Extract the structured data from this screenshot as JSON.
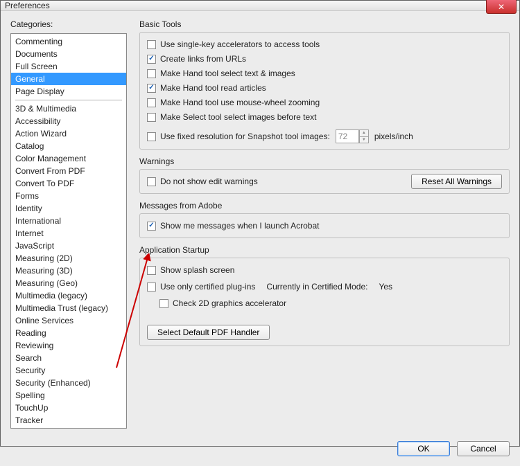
{
  "window": {
    "title": "Preferences"
  },
  "categories_label": "Categories:",
  "categories_top": [
    "Commenting",
    "Documents",
    "Full Screen",
    "General",
    "Page Display"
  ],
  "categories_selected": "General",
  "categories_rest": [
    "3D & Multimedia",
    "Accessibility",
    "Action Wizard",
    "Catalog",
    "Color Management",
    "Convert From PDF",
    "Convert To PDF",
    "Forms",
    "Identity",
    "International",
    "Internet",
    "JavaScript",
    "Measuring (2D)",
    "Measuring (3D)",
    "Measuring (Geo)",
    "Multimedia (legacy)",
    "Multimedia Trust (legacy)",
    "Online Services",
    "Reading",
    "Reviewing",
    "Search",
    "Security",
    "Security (Enhanced)",
    "Spelling",
    "TouchUp",
    "Tracker"
  ],
  "groups": {
    "basic": {
      "title": "Basic Tools",
      "opts": {
        "single_key": "Use single-key accelerators to access tools",
        "create_links": "Create links from URLs",
        "hand_text_images": "Make Hand tool select text & images",
        "hand_articles": "Make Hand tool read articles",
        "hand_wheel": "Make Hand tool use mouse-wheel zooming",
        "select_images": "Make Select tool select images before text",
        "snapshot": "Use fixed resolution for Snapshot tool images:",
        "snapshot_value": "72",
        "snapshot_unit": "pixels/inch"
      }
    },
    "warnings": {
      "title": "Warnings",
      "opt": "Do not show edit warnings",
      "reset": "Reset All Warnings"
    },
    "messages": {
      "title": "Messages from Adobe",
      "opt": "Show me messages when I launch Acrobat"
    },
    "startup": {
      "title": "Application Startup",
      "splash": "Show splash screen",
      "certified": "Use only certified plug-ins",
      "certified_status_label": "Currently in Certified Mode:",
      "certified_status_value": "Yes",
      "gfx": "Check 2D graphics accelerator",
      "handler": "Select Default PDF Handler"
    }
  },
  "footer": {
    "ok": "OK",
    "cancel": "Cancel"
  }
}
